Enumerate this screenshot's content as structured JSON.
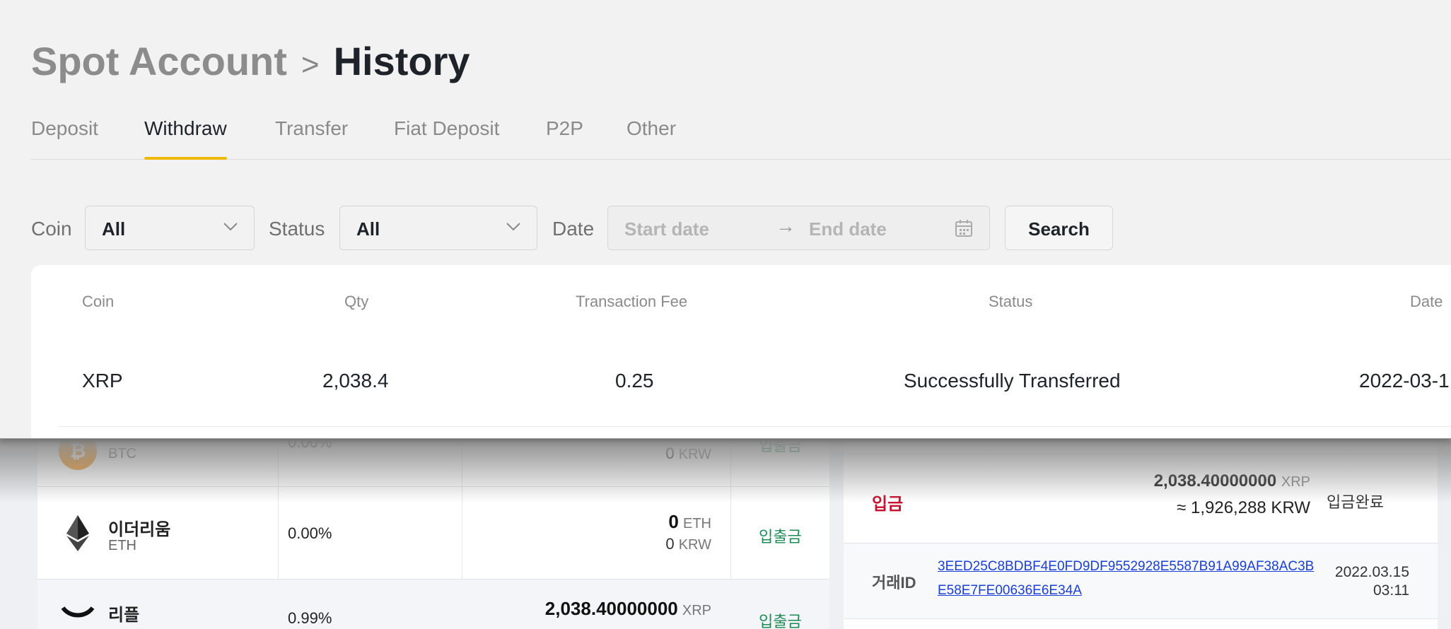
{
  "top": {
    "breadcrumb": {
      "parent": "Spot Account",
      "separator": ">",
      "current": "History"
    },
    "tabs": [
      {
        "label": "Deposit",
        "active": false
      },
      {
        "label": "Withdraw",
        "active": true
      },
      {
        "label": "Transfer",
        "active": false
      },
      {
        "label": "Fiat Deposit",
        "active": false
      },
      {
        "label": "P2P",
        "active": false
      },
      {
        "label": "Other",
        "active": false
      }
    ],
    "filters": {
      "coin_label": "Coin",
      "coin_value": "All",
      "status_label": "Status",
      "status_value": "All",
      "date_label": "Date",
      "start_placeholder": "Start date",
      "end_placeholder": "End date",
      "arrow": "→",
      "search_label": "Search"
    },
    "table": {
      "headers": [
        "Coin",
        "Qty",
        "Transaction Fee",
        "Status",
        "Date"
      ],
      "rows": [
        {
          "coin": "XRP",
          "qty": "2,038.4",
          "fee": "0.25",
          "status": "Successfully Transferred",
          "date": "2022-03-1"
        }
      ]
    },
    "accent_color": "#f0b90b"
  },
  "bottom": {
    "assets": [
      {
        "name": "",
        "symbol": "BTC",
        "percent": "0.00%",
        "amount": "",
        "amount_unit": "",
        "krw": "0",
        "krw_unit": "KRW",
        "action": "입출금",
        "icon": "bitcoin-icon"
      },
      {
        "name": "이더리움",
        "symbol": "ETH",
        "percent": "0.00%",
        "amount": "0",
        "amount_unit": "ETH",
        "krw": "0",
        "krw_unit": "KRW",
        "action": "입출금",
        "icon": "ethereum-icon"
      },
      {
        "name": "리플",
        "symbol": "",
        "percent": "0.99%",
        "amount": "2,038.40000000",
        "amount_unit": "XRP",
        "krw": "",
        "krw_unit": "",
        "action": "입출금",
        "icon": "ripple-icon"
      }
    ],
    "history": {
      "type": "입금",
      "amount": "2,038.40000000",
      "amount_unit": "XRP",
      "krw_approx": "≈ 1,926,288 KRW",
      "status": "입금완료",
      "txid_label": "거래ID",
      "txid": "3EED25C8BDBF4E0FD9DF9552928E5587B91A99AF38AC3BE58E7FE00636E6E34A",
      "date": "2022.03.15",
      "time": "03:11"
    }
  }
}
